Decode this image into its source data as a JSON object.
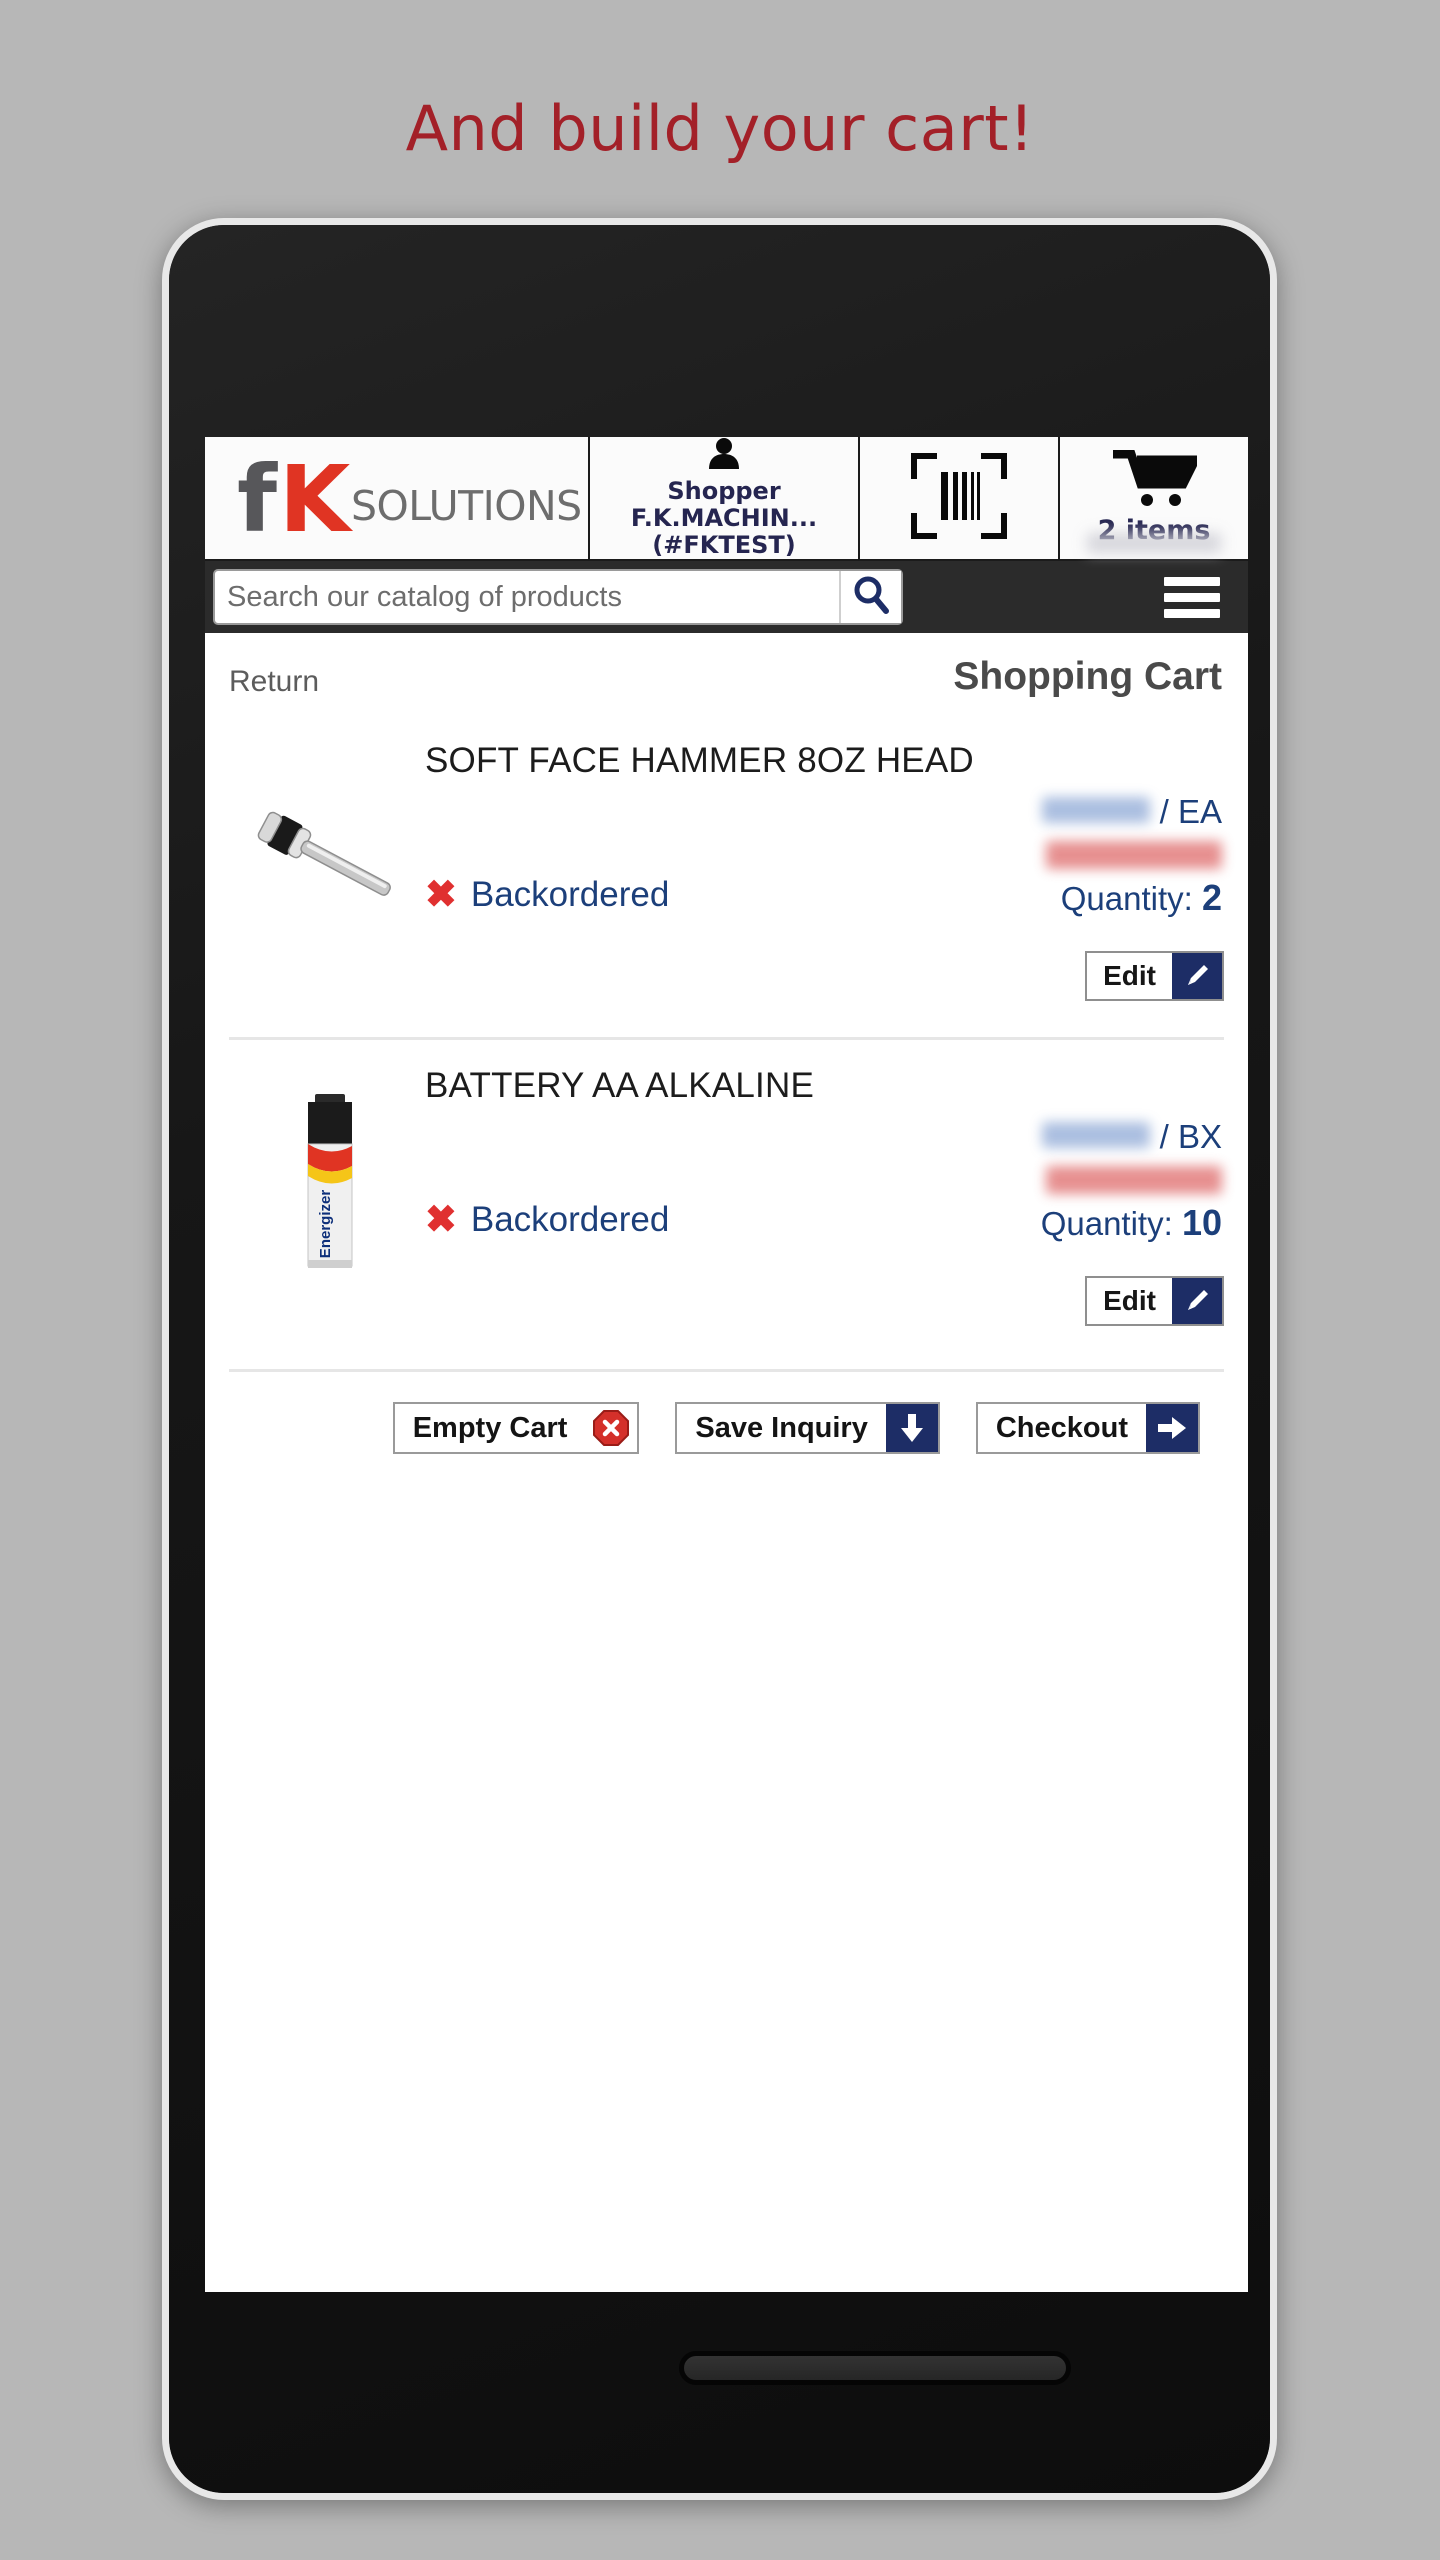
{
  "slide": {
    "headline": "And build your cart!",
    "headline_color": "#a32028",
    "background_color": "#b7b7b7"
  },
  "appbar": {
    "logo": {
      "letter_f": "f",
      "letter_k": "K",
      "word": "SOLUTIONS",
      "f_color": "#57575a",
      "k_color": "#e03423"
    },
    "shopper": {
      "icon": "person-icon",
      "label": "Shopper",
      "name": "F.K.MACHIN...",
      "account": "(#FKTEST)",
      "color": "#252550"
    },
    "scan": {
      "icon": "barcode-scan-icon"
    },
    "cart": {
      "icon": "shopping-cart-icon",
      "count_label": "2 items"
    }
  },
  "search": {
    "placeholder": "Search our catalog of products",
    "value": "",
    "icon": "search-icon",
    "menu_icon": "hamburger-menu-icon"
  },
  "pagehead": {
    "return_label": "Return",
    "title": "Shopping Cart"
  },
  "cart": {
    "items": [
      {
        "name": "SOFT FACE HAMMER 8OZ HEAD",
        "thumb": "hammer-image",
        "unit_price": "",
        "uom": "/ EA",
        "extended_price": "",
        "status": "Backordered",
        "status_icon": "x-mark-icon",
        "quantity_label": "Quantity:",
        "quantity": "2",
        "edit_label": "Edit",
        "edit_icon": "pencil-icon"
      },
      {
        "name": "BATTERY AA ALKALINE",
        "thumb": "battery-image",
        "unit_price": "",
        "uom": "/ BX",
        "extended_price": "",
        "status": "Backordered",
        "status_icon": "x-mark-icon",
        "quantity_label": "Quantity:",
        "quantity": "10",
        "edit_label": "Edit",
        "edit_icon": "pencil-icon"
      }
    ]
  },
  "actions": {
    "empty_cart": {
      "label": "Empty Cart",
      "icon": "stop-x-icon"
    },
    "save_inquiry": {
      "label": "Save Inquiry",
      "icon": "download-arrow-icon"
    },
    "checkout": {
      "label": "Checkout",
      "icon": "right-arrow-icon"
    }
  },
  "colors": {
    "accent_navy": "#1d2d66",
    "link_blue": "#1c3f7a",
    "alert_red": "#e03030",
    "brand_red": "#e03423"
  }
}
